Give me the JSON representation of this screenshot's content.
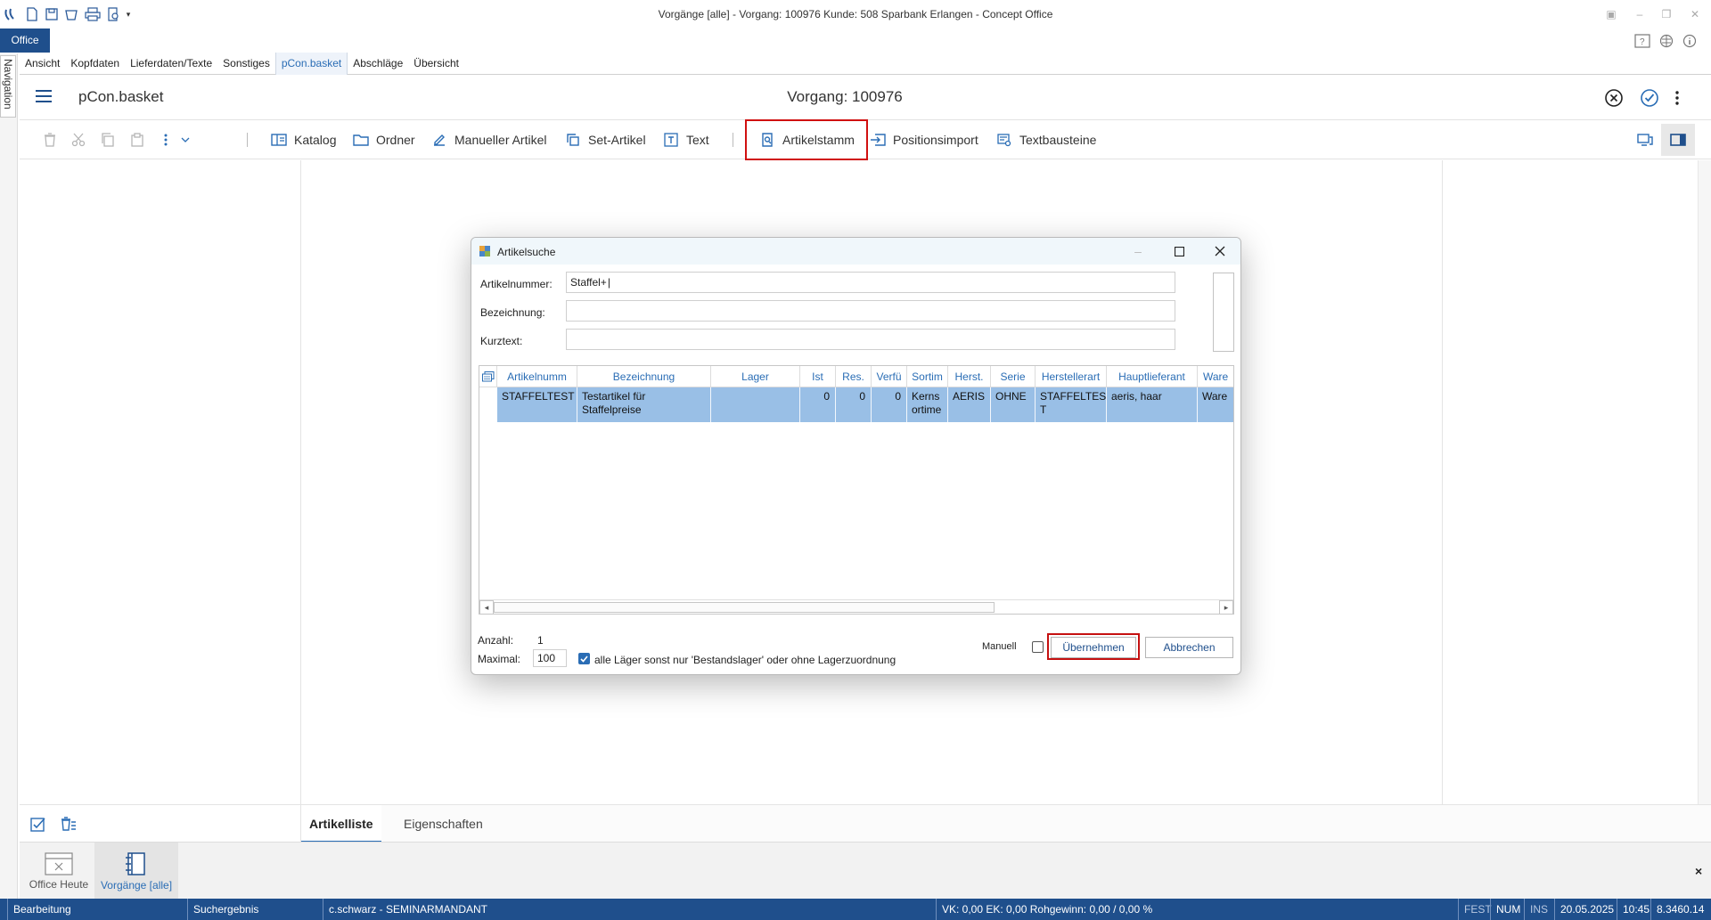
{
  "window": {
    "title": "Vorgänge [alle] - Vorgang: 100976 Kunde: 508 Sparbank Erlangen - Concept Office",
    "office_tab": "Office"
  },
  "menu": {
    "items": [
      "Ansicht",
      "Kopfdaten",
      "Lieferdaten/Texte",
      "Sonstiges",
      "pCon.basket",
      "Abschläge",
      "Übersicht"
    ],
    "active": "pCon.basket"
  },
  "nav": {
    "label": "Navigation"
  },
  "header": {
    "app_name": "pCon.basket",
    "vorgang_title": "Vorgang: 100976"
  },
  "toolbar": {
    "katalog": "Katalog",
    "ordner": "Ordner",
    "manueller_artikel": "Manueller Artikel",
    "set_artikel": "Set-Artikel",
    "text": "Text",
    "artikelstamm": "Artikelstamm",
    "positionsimport": "Positionsimport",
    "textbausteine": "Textbausteine"
  },
  "bottom_tabs": {
    "artikelliste": "Artikelliste",
    "eigenschaften": "Eigenschaften"
  },
  "bottom_nav": {
    "office_heute": "Office Heute",
    "vorgaenge": "Vorgänge [alle]",
    "close": "×"
  },
  "statusbar": {
    "mode": "Bearbeitung",
    "search": "Suchergebnis",
    "user": "c.schwarz - SEMINARMANDANT",
    "totals": "VK: 0,00 EK: 0,00 Rohgewinn: 0,00  / 0,00 %",
    "fest": "FEST",
    "num": "NUM",
    "ins": "INS",
    "date": "20.05.2025",
    "time": "10:45",
    "version": "8.3460.14"
  },
  "dialog": {
    "title": "Artikelsuche",
    "fields": {
      "artikelnummer_label": "Artikelnummer:",
      "artikelnummer_value": "Staffel+",
      "bezeichnung_label": "Bezeichnung:",
      "bezeichnung_value": "",
      "kurztext_label": "Kurztext:",
      "kurztext_value": ""
    },
    "grid": {
      "columns": [
        "Artikelnumm",
        "Bezeichnung",
        "Lager",
        "Ist",
        "Res.",
        "Verfü",
        "Sortim",
        "Herst.",
        "Serie",
        "Herstellerart",
        "Hauptlieferant",
        "Ware"
      ],
      "rows": [
        {
          "artikelnummer": "STAFFELTEST",
          "bezeichnung_1": "Testartikel für",
          "bezeichnung_2": "Staffelpreise",
          "lager": "",
          "ist": "0",
          "res": "0",
          "verfuegbar": "0",
          "sortiment_1": "Kerns",
          "sortiment_2": "ortime",
          "hersteller": "AERIS",
          "serie": "OHNE",
          "herstellerart_1": "STAFFELTES",
          "herstellerart_2": "T",
          "hauptlieferant": "aeris, haar",
          "ware": "Ware"
        }
      ]
    },
    "anzahl_label": "Anzahl:",
    "anzahl_value": "1",
    "maximal_label": "Maximal:",
    "maximal_value": "100",
    "lager_checkbox_label": "alle Läger sonst nur 'Bestandslager' oder ohne Lagerzuordnung",
    "lager_checked": true,
    "manuell_label": "Manuell",
    "manuell_checked": false,
    "ok_button": "Übernehmen",
    "cancel_button": "Abbrechen"
  },
  "colors": {
    "brand_blue": "#1f4f8c",
    "accent_blue": "#2a6db5",
    "selection": "#99bfe6",
    "highlight_red": "#d01010"
  }
}
